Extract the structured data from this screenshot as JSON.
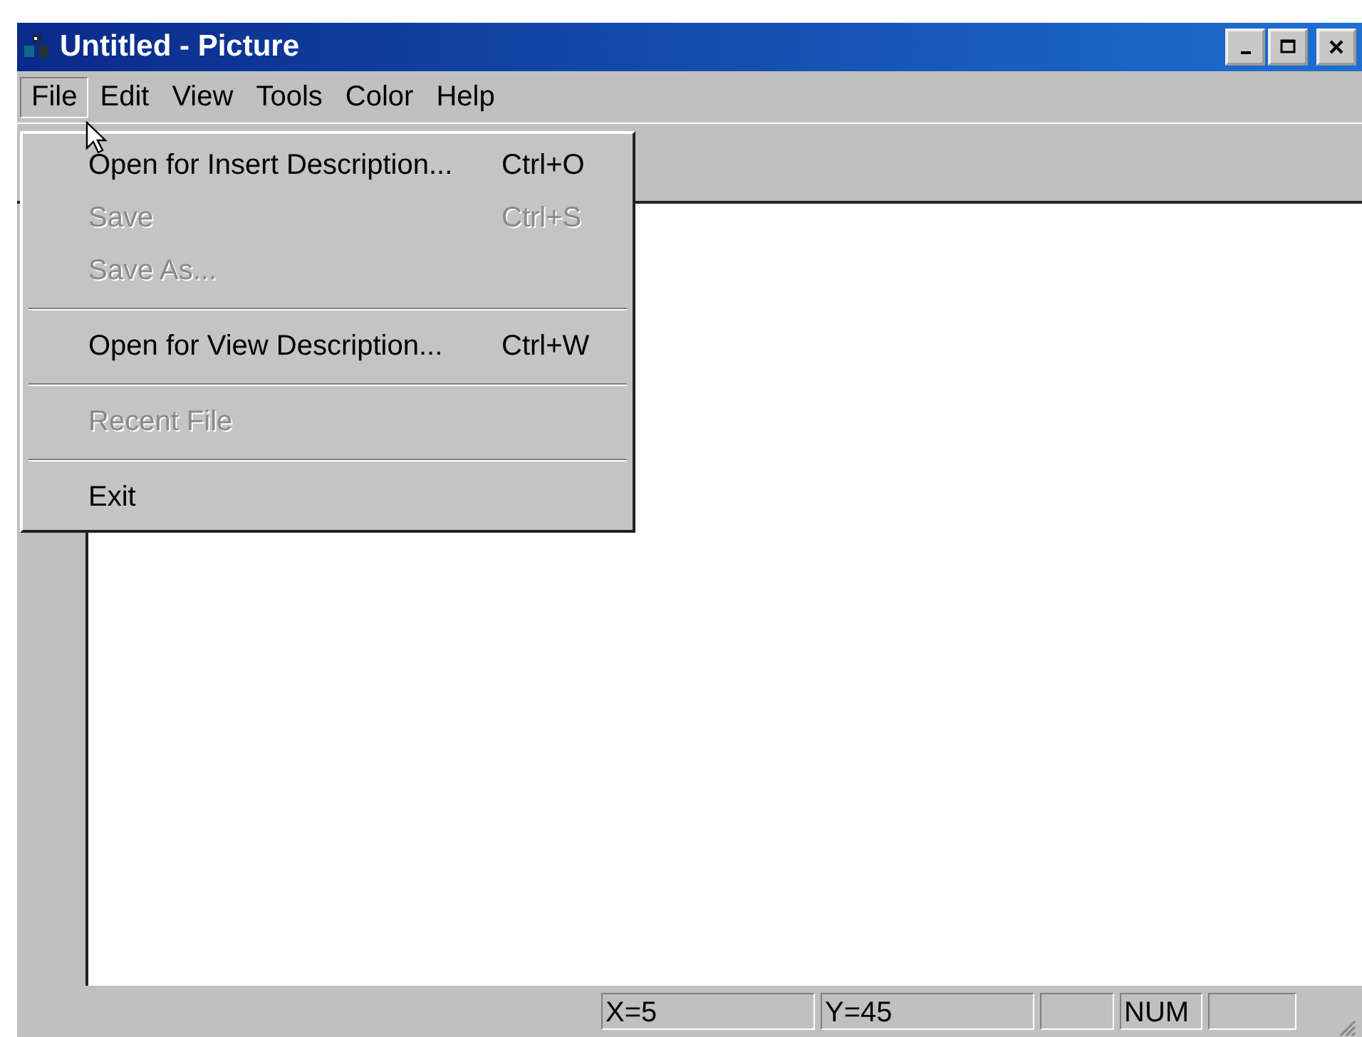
{
  "window": {
    "title": "Untitled - Picture"
  },
  "menubar": [
    {
      "label": "File",
      "selected": true
    },
    {
      "label": "Edit",
      "selected": false
    },
    {
      "label": "View",
      "selected": false
    },
    {
      "label": "Tools",
      "selected": false
    },
    {
      "label": "Color",
      "selected": false
    },
    {
      "label": "Help",
      "selected": false
    }
  ],
  "file_menu": [
    {
      "kind": "item",
      "label": "Open for Insert Description...",
      "shortcut": "Ctrl+O",
      "disabled": false
    },
    {
      "kind": "item",
      "label": "Save",
      "shortcut": "Ctrl+S",
      "disabled": true
    },
    {
      "kind": "item",
      "label": "Save As...",
      "disabled": true
    },
    {
      "kind": "separator"
    },
    {
      "kind": "item",
      "label": "Open for View Description...",
      "shortcut": "Ctrl+W",
      "disabled": false
    },
    {
      "kind": "separator"
    },
    {
      "kind": "item",
      "label": "Recent File",
      "disabled": true
    },
    {
      "kind": "separator"
    },
    {
      "kind": "item",
      "label": "Exit",
      "disabled": false
    }
  ],
  "status_bar": {
    "x_position": "X=5",
    "y_position": "Y=45",
    "num_lock": "NUM"
  }
}
